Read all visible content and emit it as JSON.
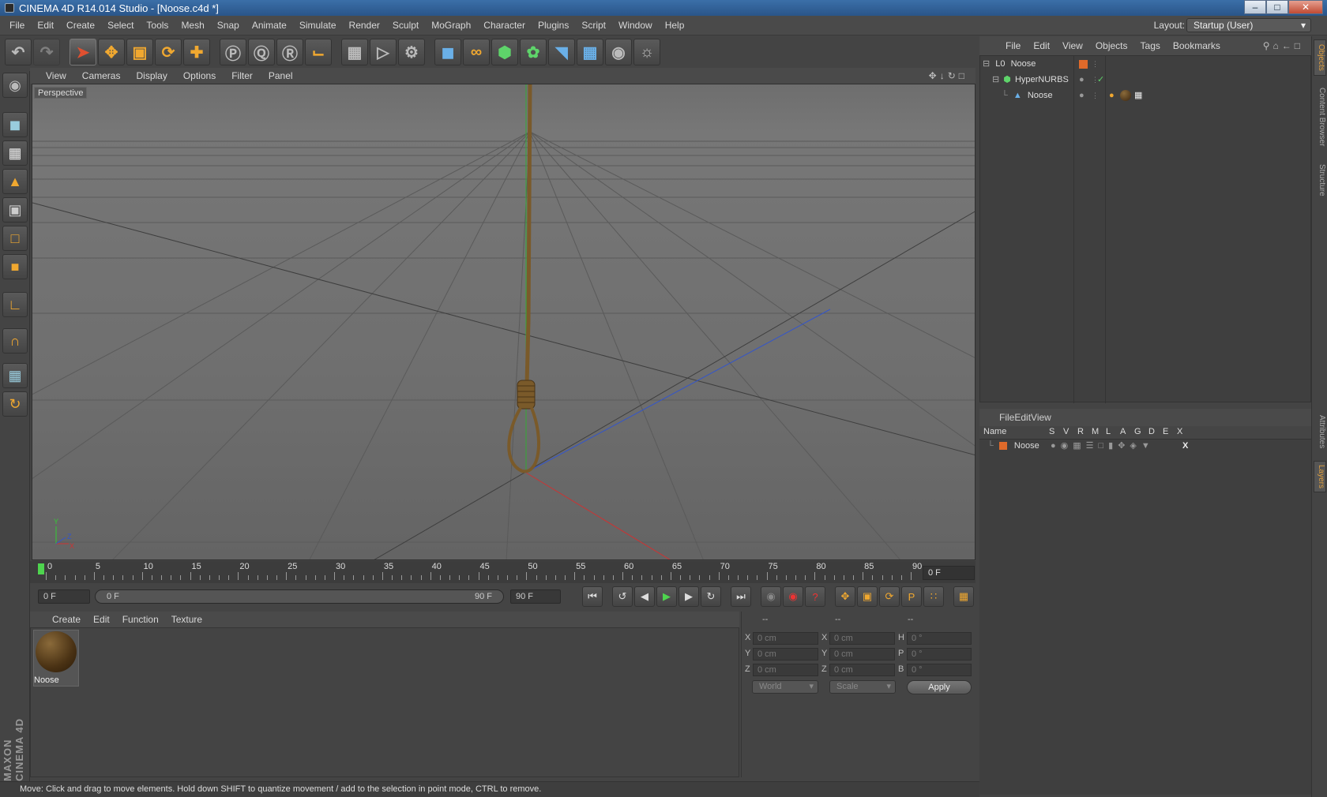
{
  "window": {
    "title": "CINEMA 4D R14.014 Studio - [Noose.c4d *]"
  },
  "menubar": {
    "items": [
      "File",
      "Edit",
      "Create",
      "Select",
      "Tools",
      "Mesh",
      "Snap",
      "Animate",
      "Simulate",
      "Render",
      "Sculpt",
      "MoGraph",
      "Character",
      "Plugins",
      "Script",
      "Window",
      "Help"
    ]
  },
  "layout": {
    "label": "Layout:",
    "value": "Startup (User)"
  },
  "viewport": {
    "menu": [
      "View",
      "Cameras",
      "Display",
      "Options",
      "Filter",
      "Panel"
    ],
    "label": "Perspective",
    "axis_labels": {
      "y": "Y",
      "z": "Z",
      "x": "X"
    }
  },
  "timeline": {
    "ticks": [
      "0",
      "5",
      "10",
      "15",
      "20",
      "25",
      "30",
      "35",
      "40",
      "45",
      "50",
      "55",
      "60",
      "65",
      "70",
      "75",
      "80",
      "85",
      "90"
    ],
    "current_frame": "0 F",
    "start_field": "0 F",
    "range_start": "0 F",
    "range_end": "90 F",
    "end_field": "90 F"
  },
  "material_manager": {
    "menu": [
      "Create",
      "Edit",
      "Function",
      "Texture"
    ],
    "materials": [
      {
        "name": "Noose"
      }
    ]
  },
  "coordinates": {
    "headers": [
      "--",
      "--",
      "--"
    ],
    "rows": [
      {
        "a": "X",
        "av": "0 cm",
        "b": "X",
        "bv": "0 cm",
        "c": "H",
        "cv": "0 °"
      },
      {
        "a": "Y",
        "av": "0 cm",
        "b": "Y",
        "bv": "0 cm",
        "c": "P",
        "cv": "0 °"
      },
      {
        "a": "Z",
        "av": "0 cm",
        "b": "Z",
        "bv": "0 cm",
        "c": "B",
        "cv": "0 °"
      }
    ],
    "space": "World",
    "mode": "Scale",
    "apply": "Apply"
  },
  "status": "Move: Click and drag to move elements. Hold down SHIFT to quantize movement / add to the selection in point mode, CTRL to remove.",
  "object_manager": {
    "menu": [
      "File",
      "Edit",
      "View",
      "Objects",
      "Tags",
      "Bookmarks"
    ],
    "objects": [
      {
        "name": "Noose"
      },
      {
        "name": "HyperNURBS"
      },
      {
        "name": "Noose"
      }
    ]
  },
  "layer_manager": {
    "menu": [
      "File",
      "Edit",
      "View"
    ],
    "columns": [
      "Name",
      "S",
      "V",
      "R",
      "M",
      "L",
      "A",
      "G",
      "D",
      "E",
      "X"
    ],
    "layers": [
      {
        "name": "Noose"
      }
    ]
  },
  "side_tabs": [
    "Objects",
    "Content Browser",
    "Structure",
    "Attributes",
    "Layers"
  ],
  "brand": "MAXON CINEMA 4D",
  "colors": {
    "accent": "#f0a830",
    "title_bar": "#2a5589",
    "play": "#4ed44e",
    "layer": "#e06a2a"
  }
}
